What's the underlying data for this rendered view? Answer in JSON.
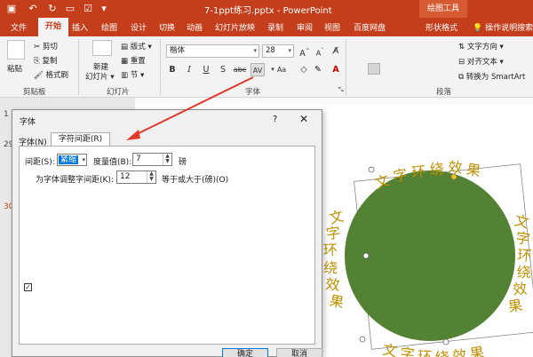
{
  "titlebar": {
    "doc_title": "7-1ppt练习.pptx - PowerPoint",
    "tool_tab_title": "绘图工具"
  },
  "tabs": [
    "文件",
    "开始",
    "插入",
    "绘图",
    "设计",
    "切换",
    "动画",
    "幻灯片放映",
    "录制",
    "审阅",
    "视图",
    "百度网盘",
    "形状格式"
  ],
  "help_search": "操作说明搜索",
  "ribbon": {
    "clipboard": {
      "paste": "粘贴",
      "cut": "剪切",
      "copy": "复制",
      "format_painter": "格式刷",
      "label": "剪贴板"
    },
    "slides": {
      "new_slide_1": "新建",
      "new_slide_2": "幻灯片",
      "layout": "版式",
      "reset": "重置",
      "section": "节",
      "label": "幻灯片"
    },
    "font": {
      "font_name": "楷体",
      "font_size": "28",
      "bold": "B",
      "italic": "I",
      "underline": "U",
      "shadow": "S",
      "strike": "abc",
      "spacing": "AV",
      "case": "Aa",
      "label": "字体"
    },
    "paragraph": {
      "text_direction": "文字方向",
      "align_text": "对齐文本",
      "smartart": "转换为 SmartArt",
      "label": "段落"
    }
  },
  "slide_pane": {
    "num_1": "1",
    "num_29": "29",
    "num_30": "30"
  },
  "dialog": {
    "title": "字体",
    "help": "?",
    "close": "✕",
    "tab_font": "字体(N)",
    "tab_spacing": "字符间距(R)",
    "spacing_label": "间距(S):",
    "spacing_value": "紧缩",
    "amount_label": "度量值(B):",
    "amount_value": "7",
    "amount_unit": "磅",
    "kerning_label": "为字体调整字间距(K):",
    "kerning_value": "12",
    "kerning_suffix": "等于或大于(磅)(O)",
    "ok": "确定",
    "cancel": "取消"
  },
  "slide": {
    "arc_text": "文字环绕效果",
    "circle_color": "#548235",
    "text_color": "#bf9000"
  },
  "colors": {
    "accent": "#c43e1c",
    "arrow": "#e03a2a"
  }
}
